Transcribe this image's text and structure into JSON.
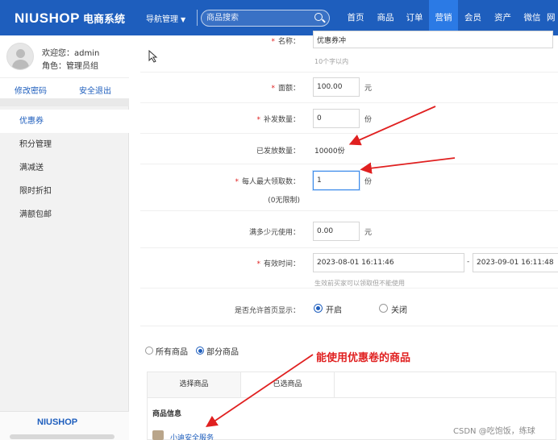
{
  "topbar": {
    "logo_main": "NIUSHOP",
    "logo_sub": "电商系统",
    "nav_select": "导航管理",
    "search_placeholder": "商品搜索",
    "nav_items": [
      {
        "label": "首页",
        "active": false
      },
      {
        "label": "商品",
        "active": false
      },
      {
        "label": "订单",
        "active": false
      },
      {
        "label": "营销",
        "active": true
      },
      {
        "label": "会员",
        "active": false
      },
      {
        "label": "资产",
        "active": false
      },
      {
        "label": "微信",
        "active": false
      },
      {
        "label": "网",
        "active": false
      }
    ]
  },
  "sidebar": {
    "welcome": "欢迎您：admin",
    "role": "角色：管理员组",
    "change_password": "修改密码",
    "logout": "安全退出",
    "menu": [
      {
        "label": "优惠券",
        "active": true
      },
      {
        "label": "积分管理",
        "active": false
      },
      {
        "label": "满减送",
        "active": false
      },
      {
        "label": "限时折扣",
        "active": false
      },
      {
        "label": "满额包邮",
        "active": false
      }
    ],
    "footer_logo": "NIUSHOP"
  },
  "form": {
    "name_label": "名称：",
    "name_value": "优惠券冲",
    "name_hint": "10个字以内",
    "amount_label": "面额：",
    "amount_value": "100.00",
    "amount_unit": "元",
    "supply_label": "补发数量：",
    "supply_value": "0",
    "supply_unit": "份",
    "issued_label": "已发放数量：",
    "issued_value": "10000份",
    "maxget_label": "每人最大领取数：",
    "maxget_value": "1",
    "maxget_unit": "份",
    "maxget_note": "(0无限制)",
    "minuse_label": "满多少元使用：",
    "minuse_value": "0.00",
    "minuse_unit": "元",
    "valid_label": "有效时间：",
    "valid_start": "2023-08-01 16:11:46",
    "valid_sep": "-",
    "valid_end": "2023-09-01 16:11:48",
    "valid_hint": "生效前买家可以领取但不能使用",
    "homepage_label": "是否允许首页显示：",
    "homepage_on": "开启",
    "homepage_off": "关闭",
    "homepage_enabled": true
  },
  "goods_scope": {
    "all_goods": "所有商品",
    "partial_goods": "部分商品",
    "partial_selected": true,
    "tab_select": "选择商品",
    "tab_selected": "已选商品",
    "table_header": "商品信息",
    "goods_name": "小迪安全服务"
  },
  "annotation": "能使用优惠卷的商品",
  "watermark": "CSDN @吃饱饭，练球",
  "colors": {
    "brand_blue": "#1e5ebd",
    "active_nav": "#2b7ae5",
    "annotation_red": "#e02020"
  }
}
